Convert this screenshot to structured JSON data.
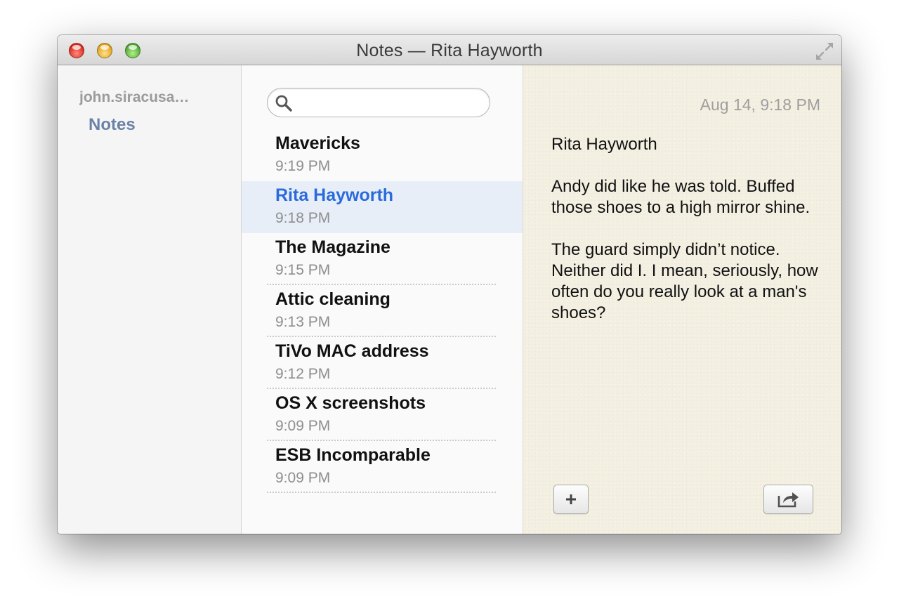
{
  "window": {
    "title": "Notes — Rita Hayworth"
  },
  "sidebar": {
    "account": "john.siracusa…",
    "folder": "Notes"
  },
  "search": {
    "value": "",
    "placeholder": ""
  },
  "notes": [
    {
      "title": "Mavericks",
      "time": "9:19 PM"
    },
    {
      "title": "Rita Hayworth",
      "time": "9:18 PM"
    },
    {
      "title": "The Magazine",
      "time": "9:15 PM"
    },
    {
      "title": "Attic cleaning",
      "time": "9:13 PM"
    },
    {
      "title": "TiVo MAC address",
      "time": "9:12 PM"
    },
    {
      "title": "OS X screenshots",
      "time": "9:09 PM"
    },
    {
      "title": "ESB Incomparable",
      "time": "9:09 PM"
    }
  ],
  "selected_note": "Rita Hayworth",
  "editor": {
    "date": "Aug 14, 9:18 PM",
    "paragraphs": [
      "Rita Hayworth",
      "Andy did like he was told. Buffed those shoes to a high mirror shine.",
      "The guard simply didn’t notice. Neither did I. I mean, seriously, how often do you really look at a man's shoes?"
    ]
  },
  "icons": {
    "close": "close-icon",
    "minimize": "minimize-icon",
    "zoom": "zoom-icon",
    "fullscreen": "fullscreen-icon",
    "search": "search-icon",
    "add": "plus-icon",
    "share": "share-icon"
  },
  "colors": {
    "selected_title": "#2a6bdc",
    "selected_row": "#e8eef8",
    "folder": "#6b82a8",
    "paper": "#f3f0e2"
  }
}
